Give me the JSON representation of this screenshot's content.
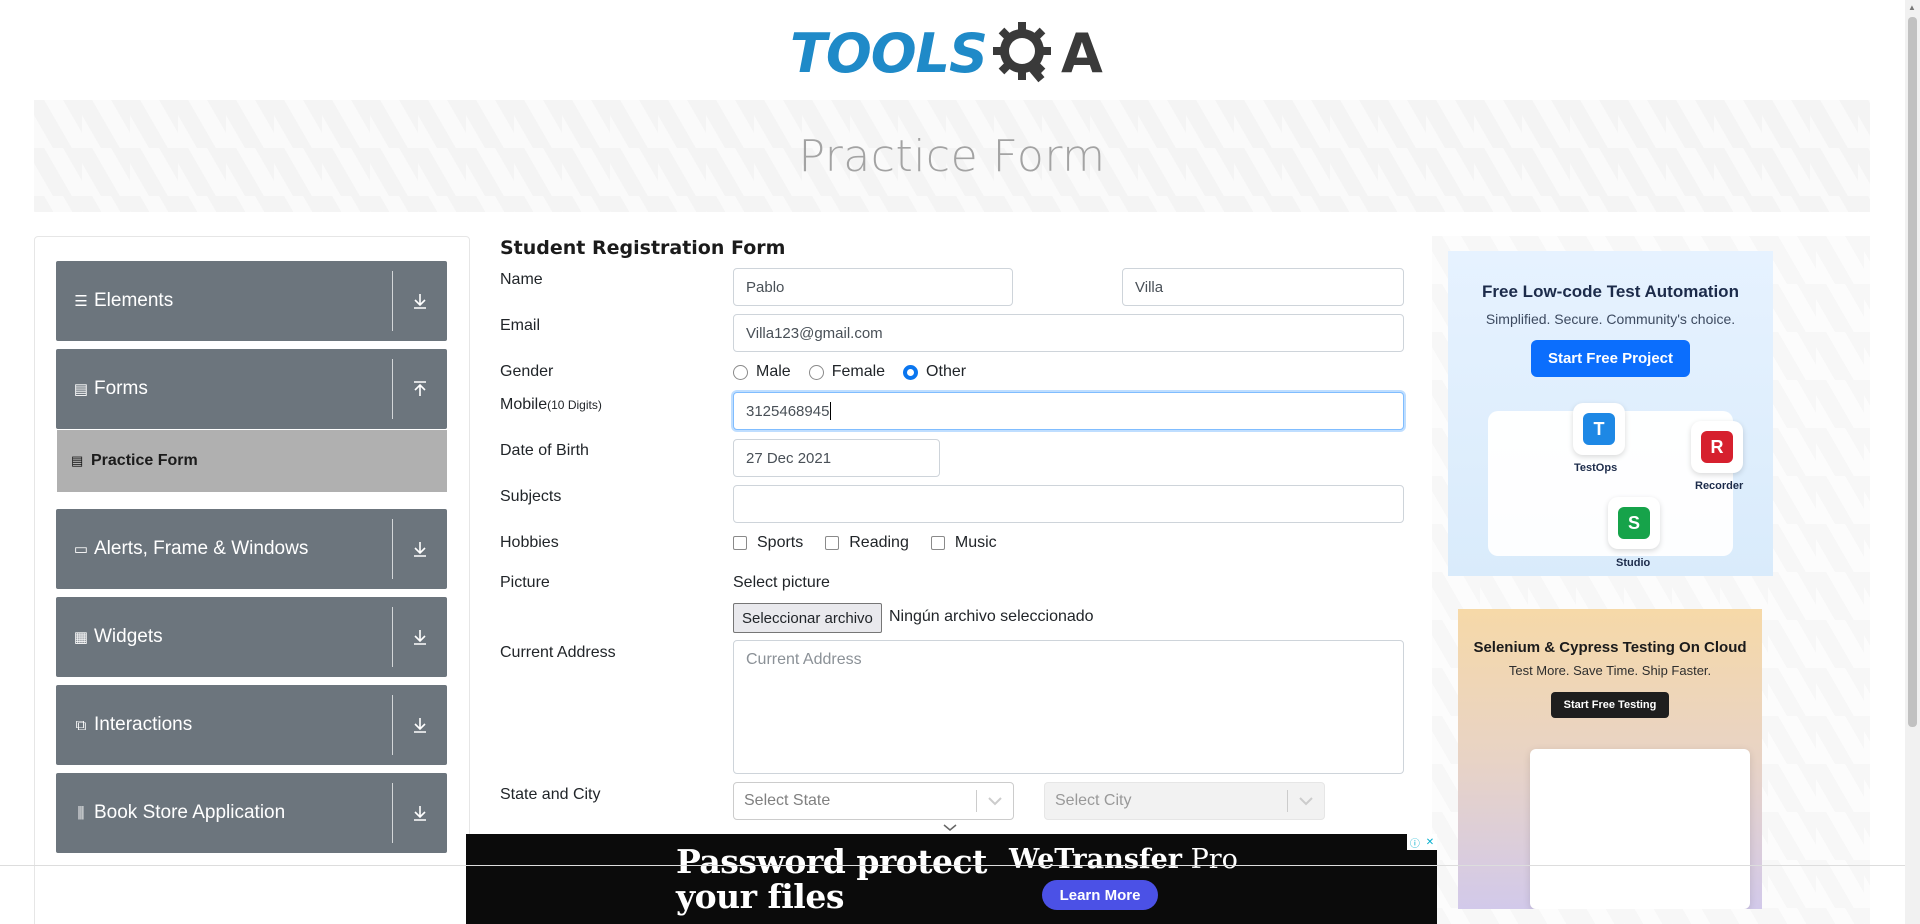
{
  "logo": {
    "text": "TOOLS",
    "suffix": "A",
    "color": "#1f8ac8"
  },
  "banner": {
    "title": "Practice Form"
  },
  "sidebar": {
    "groups": [
      {
        "label": "Elements",
        "icon": "hamburger-icon"
      },
      {
        "label": "Forms",
        "icon": "document-icon"
      },
      {
        "label": "Alerts, Frame & Windows",
        "icon": "window-icon"
      },
      {
        "label": "Widgets",
        "icon": "grid-icon"
      },
      {
        "label": "Interactions",
        "icon": "interaction-icon"
      },
      {
        "label": "Book Store Application",
        "icon": "books-icon"
      }
    ],
    "active_item": {
      "label": "Practice Form",
      "icon": "document-icon"
    },
    "color": "#6c757d"
  },
  "form": {
    "title": "Student Registration Form",
    "name_label": "Name",
    "first_name": "Pablo",
    "last_name": "Villa",
    "email_label": "Email",
    "email": "Villa123@gmail.com",
    "gender_label": "Gender",
    "genders": [
      "Male",
      "Female",
      "Other"
    ],
    "selected_gender": "Other",
    "mobile_label": "Mobile",
    "mobile_hint": "(10 Digits)",
    "mobile": "3125468945",
    "dob_label": "Date of Birth",
    "dob": "27 Dec 2021",
    "subjects_label": "Subjects",
    "subjects": "",
    "hobbies_label": "Hobbies",
    "hobbies": [
      "Sports",
      "Reading",
      "Music"
    ],
    "picture_label": "Picture",
    "select_picture": "Select picture",
    "file_button": "Seleccionar archivo",
    "file_status": "Ningún archivo seleccionado",
    "address_label": "Current Address",
    "address_placeholder": "Current Address",
    "state_city_label": "State and City",
    "state_placeholder": "Select State",
    "city_placeholder": "Select City",
    "accent_color": "#0b76ef"
  },
  "ads": {
    "ad1": {
      "title": "Free Low-code Test Automation",
      "subtitle": "Simplified. Secure. Community's choice.",
      "button": "Start Free Project",
      "tiles": [
        "TestOps",
        "Recorder",
        "Studio"
      ]
    },
    "ad2": {
      "title": "Selenium & Cypress Testing On Cloud",
      "subtitle": "Test More. Save Time. Ship Faster.",
      "button": "Start Free Testing"
    },
    "bottom": {
      "headline_1": "Password protect",
      "headline_2": "your files",
      "brand": "WeTransfer",
      "brand_suffix": "Pro",
      "button": "Learn More",
      "button_color": "#4b51e6"
    }
  }
}
